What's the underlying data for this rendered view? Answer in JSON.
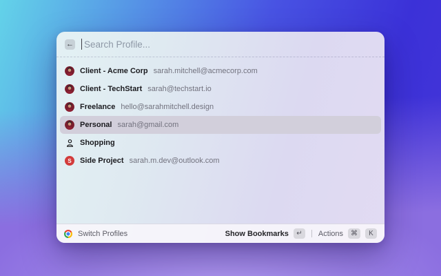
{
  "panel": {
    "search": {
      "placeholder": "Search Profile...",
      "back_icon": "←"
    },
    "profiles": [
      {
        "name": "Client - Acme Corp",
        "email": "sarah.mitchell@acmecorp.com",
        "avatar": "photo",
        "selected": false
      },
      {
        "name": "Client - TechStart",
        "email": "sarah@techstart.io",
        "avatar": "photo",
        "selected": false
      },
      {
        "name": "Freelance",
        "email": "hello@sarahmitchell.design",
        "avatar": "photo",
        "selected": false
      },
      {
        "name": "Personal",
        "email": "sarah@gmail.com",
        "avatar": "photo",
        "selected": true
      },
      {
        "name": "Shopping",
        "email": "",
        "avatar": "person-outline",
        "selected": false
      },
      {
        "name": "Side Project",
        "email": "sarah.m.dev@outlook.com",
        "avatar": "letter",
        "letter": "S",
        "letter_color": "#d23b3b",
        "selected": false
      }
    ],
    "footer": {
      "switch_label": "Switch Profiles",
      "bookmarks_label": "Show Bookmarks",
      "bookmarks_key": "↵",
      "divider": "|",
      "actions_label": "Actions",
      "actions_keys": [
        "⌘",
        "K"
      ]
    },
    "colors": {
      "selected_row_bg": "#d2cfdb",
      "side_project_red": "#d23b3b"
    }
  }
}
